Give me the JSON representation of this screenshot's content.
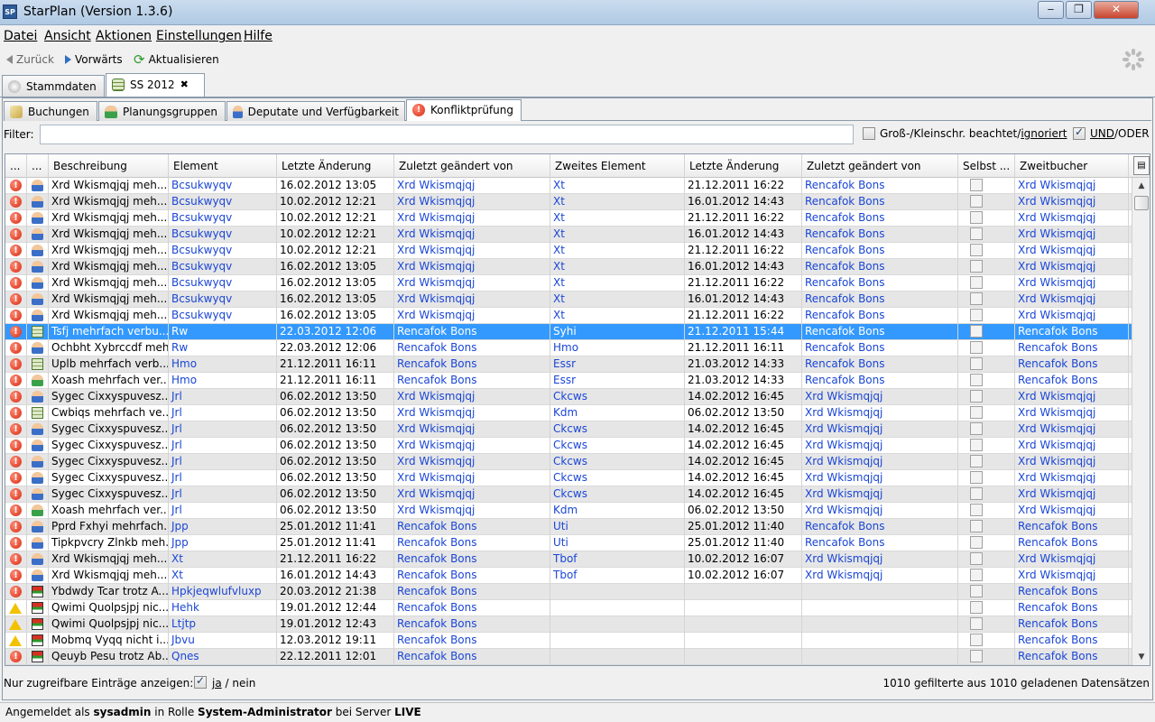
{
  "window": {
    "title": "StarPlan (Version 1.3.6)",
    "icon_text": "SP",
    "minimize": "‒",
    "maximize": "❐",
    "close": "✕"
  },
  "menu": [
    "Datei",
    "Ansicht",
    "Aktionen",
    "Einstellungen",
    "Hilfe"
  ],
  "nav": {
    "back": "Zurück",
    "forward": "Vorwärts",
    "refresh": "Aktualisieren"
  },
  "tabs_main": [
    {
      "label": "Stammdaten"
    },
    {
      "label": "SS 2012",
      "close": "✖"
    }
  ],
  "tabs_sub": [
    "Buchungen",
    "Planungsgruppen",
    "Deputate und Verfügbarkeit",
    "Konfliktprüfung"
  ],
  "filter": {
    "label": "Filter:",
    "value": "",
    "case_label_a": "Groß-/Kleinschr. beachtet/",
    "case_label_b": "ignoriert",
    "case_checked": false,
    "andor_a": "UND",
    "andor_b": "/ODER",
    "andor_checked": true
  },
  "columns": [
    "...",
    "...",
    "Beschreibung",
    "Element",
    "Letzte Änderung",
    "Zuletzt geändert von",
    "Zweites Element",
    "Letzte Änderung",
    "Zuletzt geändert von",
    "Selbst ...",
    "Zweitbucher"
  ],
  "rows": [
    {
      "s": "error",
      "t": "person",
      "desc": "Xrd Wkismqjqj meh...",
      "el": "Bcsukwyqv",
      "d1": "16.02.2012 13:05",
      "by1": "Xrd Wkismqjqj",
      "el2": "Xt",
      "d2": "21.12.2011 16:22",
      "by2": "Rencafok Bons",
      "zb": "Xrd Wkismqjqj"
    },
    {
      "s": "error",
      "t": "person",
      "desc": "Xrd Wkismqjqj meh...",
      "el": "Bcsukwyqv",
      "d1": "10.02.2012 12:21",
      "by1": "Xrd Wkismqjqj",
      "el2": "Xt",
      "d2": "16.01.2012 14:43",
      "by2": "Rencafok Bons",
      "zb": "Xrd Wkismqjqj"
    },
    {
      "s": "error",
      "t": "person",
      "desc": "Xrd Wkismqjqj meh...",
      "el": "Bcsukwyqv",
      "d1": "10.02.2012 12:21",
      "by1": "Xrd Wkismqjqj",
      "el2": "Xt",
      "d2": "21.12.2011 16:22",
      "by2": "Rencafok Bons",
      "zb": "Xrd Wkismqjqj"
    },
    {
      "s": "error",
      "t": "person",
      "desc": "Xrd Wkismqjqj meh...",
      "el": "Bcsukwyqv",
      "d1": "10.02.2012 12:21",
      "by1": "Xrd Wkismqjqj",
      "el2": "Xt",
      "d2": "16.01.2012 14:43",
      "by2": "Rencafok Bons",
      "zb": "Xrd Wkismqjqj"
    },
    {
      "s": "error",
      "t": "person",
      "desc": "Xrd Wkismqjqj meh...",
      "el": "Bcsukwyqv",
      "d1": "10.02.2012 12:21",
      "by1": "Xrd Wkismqjqj",
      "el2": "Xt",
      "d2": "21.12.2011 16:22",
      "by2": "Rencafok Bons",
      "zb": "Xrd Wkismqjqj"
    },
    {
      "s": "error",
      "t": "person",
      "desc": "Xrd Wkismqjqj meh...",
      "el": "Bcsukwyqv",
      "d1": "16.02.2012 13:05",
      "by1": "Xrd Wkismqjqj",
      "el2": "Xt",
      "d2": "16.01.2012 14:43",
      "by2": "Rencafok Bons",
      "zb": "Xrd Wkismqjqj"
    },
    {
      "s": "error",
      "t": "person",
      "desc": "Xrd Wkismqjqj meh...",
      "el": "Bcsukwyqv",
      "d1": "16.02.2012 13:05",
      "by1": "Xrd Wkismqjqj",
      "el2": "Xt",
      "d2": "21.12.2011 16:22",
      "by2": "Rencafok Bons",
      "zb": "Xrd Wkismqjqj"
    },
    {
      "s": "error",
      "t": "person",
      "desc": "Xrd Wkismqjqj meh...",
      "el": "Bcsukwyqv",
      "d1": "16.02.2012 13:05",
      "by1": "Xrd Wkismqjqj",
      "el2": "Xt",
      "d2": "16.01.2012 14:43",
      "by2": "Rencafok Bons",
      "zb": "Xrd Wkismqjqj"
    },
    {
      "s": "error",
      "t": "person",
      "desc": "Xrd Wkismqjqj meh...",
      "el": "Bcsukwyqv",
      "d1": "16.02.2012 13:05",
      "by1": "Xrd Wkismqjqj",
      "el2": "Xt",
      "d2": "21.12.2011 16:22",
      "by2": "Rencafok Bons",
      "zb": "Xrd Wkismqjqj"
    },
    {
      "s": "error",
      "t": "room",
      "desc": "Tsfj mehrfach verbu...",
      "el": "Rw",
      "d1": "22.03.2012 12:06",
      "by1": "Rencafok Bons",
      "el2": "Syhi",
      "d2": "21.12.2011 15:44",
      "by2": "Rencafok Bons",
      "zb": "Rencafok Bons",
      "selected": true
    },
    {
      "s": "error",
      "t": "person",
      "desc": "Ochbht Xybrccdf meh...",
      "el": "Rw",
      "d1": "22.03.2012 12:06",
      "by1": "Rencafok Bons",
      "el2": "Hmo",
      "d2": "21.12.2011 16:11",
      "by2": "Rencafok Bons",
      "zb": "Rencafok Bons"
    },
    {
      "s": "error",
      "t": "room",
      "desc": "Uplb mehrfach verb...",
      "el": "Hmo",
      "d1": "21.12.2011 16:11",
      "by1": "Rencafok Bons",
      "el2": "Essr",
      "d2": "21.03.2012 14:33",
      "by2": "Rencafok Bons",
      "zb": "Rencafok Bons"
    },
    {
      "s": "error",
      "t": "people",
      "desc": "Xoash mehrfach ver...",
      "el": "Hmo",
      "d1": "21.12.2011 16:11",
      "by1": "Rencafok Bons",
      "el2": "Essr",
      "d2": "21.03.2012 14:33",
      "by2": "Rencafok Bons",
      "zb": "Rencafok Bons"
    },
    {
      "s": "error",
      "t": "person",
      "desc": "Sygec Cixxyspuvesz...",
      "el": "Jrl",
      "d1": "06.02.2012 13:50",
      "by1": "Xrd Wkismqjqj",
      "el2": "Ckcws",
      "d2": "14.02.2012 16:45",
      "by2": "Xrd Wkismqjqj",
      "zb": "Xrd Wkismqjqj"
    },
    {
      "s": "error",
      "t": "room",
      "desc": "Cwbiqs mehrfach ve...",
      "el": "Jrl",
      "d1": "06.02.2012 13:50",
      "by1": "Xrd Wkismqjqj",
      "el2": "Kdm",
      "d2": "06.02.2012 13:50",
      "by2": "Xrd Wkismqjqj",
      "zb": "Xrd Wkismqjqj"
    },
    {
      "s": "error",
      "t": "person",
      "desc": "Sygec Cixxyspuvesz...",
      "el": "Jrl",
      "d1": "06.02.2012 13:50",
      "by1": "Xrd Wkismqjqj",
      "el2": "Ckcws",
      "d2": "14.02.2012 16:45",
      "by2": "Xrd Wkismqjqj",
      "zb": "Xrd Wkismqjqj"
    },
    {
      "s": "error",
      "t": "person",
      "desc": "Sygec Cixxyspuvesz...",
      "el": "Jrl",
      "d1": "06.02.2012 13:50",
      "by1": "Xrd Wkismqjqj",
      "el2": "Ckcws",
      "d2": "14.02.2012 16:45",
      "by2": "Xrd Wkismqjqj",
      "zb": "Xrd Wkismqjqj"
    },
    {
      "s": "error",
      "t": "person",
      "desc": "Sygec Cixxyspuvesz...",
      "el": "Jrl",
      "d1": "06.02.2012 13:50",
      "by1": "Xrd Wkismqjqj",
      "el2": "Ckcws",
      "d2": "14.02.2012 16:45",
      "by2": "Xrd Wkismqjqj",
      "zb": "Xrd Wkismqjqj"
    },
    {
      "s": "error",
      "t": "person",
      "desc": "Sygec Cixxyspuvesz...",
      "el": "Jrl",
      "d1": "06.02.2012 13:50",
      "by1": "Xrd Wkismqjqj",
      "el2": "Ckcws",
      "d2": "14.02.2012 16:45",
      "by2": "Xrd Wkismqjqj",
      "zb": "Xrd Wkismqjqj"
    },
    {
      "s": "error",
      "t": "person",
      "desc": "Sygec Cixxyspuvesz...",
      "el": "Jrl",
      "d1": "06.02.2012 13:50",
      "by1": "Xrd Wkismqjqj",
      "el2": "Ckcws",
      "d2": "14.02.2012 16:45",
      "by2": "Xrd Wkismqjqj",
      "zb": "Xrd Wkismqjqj"
    },
    {
      "s": "error",
      "t": "people",
      "desc": "Xoash mehrfach ver...",
      "el": "Jrl",
      "d1": "06.02.2012 13:50",
      "by1": "Xrd Wkismqjqj",
      "el2": "Kdm",
      "d2": "06.02.2012 13:50",
      "by2": "Xrd Wkismqjqj",
      "zb": "Xrd Wkismqjqj"
    },
    {
      "s": "error",
      "t": "person",
      "desc": "Pprd Fxhyi mehrfach...",
      "el": "Jpp",
      "d1": "25.01.2012 11:41",
      "by1": "Rencafok Bons",
      "el2": "Uti",
      "d2": "25.01.2012 11:40",
      "by2": "Rencafok Bons",
      "zb": "Rencafok Bons"
    },
    {
      "s": "error",
      "t": "person",
      "desc": "Tipkpvcry Zlnkb meh...",
      "el": "Jpp",
      "d1": "25.01.2012 11:41",
      "by1": "Rencafok Bons",
      "el2": "Uti",
      "d2": "25.01.2012 11:40",
      "by2": "Rencafok Bons",
      "zb": "Rencafok Bons"
    },
    {
      "s": "error",
      "t": "person",
      "desc": "Xrd Wkismqjqj meh...",
      "el": "Xt",
      "d1": "21.12.2011 16:22",
      "by1": "Rencafok Bons",
      "el2": "Tbof",
      "d2": "10.02.2012 16:07",
      "by2": "Xrd Wkismqjqj",
      "zb": "Xrd Wkismqjqj"
    },
    {
      "s": "error",
      "t": "person",
      "desc": "Xrd Wkismqjqj meh...",
      "el": "Xt",
      "d1": "16.01.2012 14:43",
      "by1": "Rencafok Bons",
      "el2": "Tbof",
      "d2": "10.02.2012 16:07",
      "by2": "Xrd Wkismqjqj",
      "zb": "Xrd Wkismqjqj"
    },
    {
      "s": "error",
      "t": "chart",
      "desc": "Ybdwdy Tcar trotz A...",
      "el": "Hpkjeqwlufvluxp",
      "d1": "20.03.2012 21:38",
      "by1": "Rencafok Bons",
      "el2": "",
      "d2": "",
      "by2": "",
      "zb": "Rencafok Bons"
    },
    {
      "s": "warn",
      "t": "chart",
      "desc": "Qwimi Quolpsjpj nic...",
      "el": "Hehk",
      "d1": "19.01.2012 12:44",
      "by1": "Rencafok Bons",
      "el2": "",
      "d2": "",
      "by2": "",
      "zb": "Rencafok Bons"
    },
    {
      "s": "warn",
      "t": "chart",
      "desc": "Qwimi Quolpsjpj nic...",
      "el": "Ltjtp",
      "d1": "19.01.2012 12:43",
      "by1": "Rencafok Bons",
      "el2": "",
      "d2": "",
      "by2": "",
      "zb": "Rencafok Bons"
    },
    {
      "s": "warn",
      "t": "chart",
      "desc": "Mobmq Vyqq nicht i...",
      "el": "Jbvu",
      "d1": "12.03.2012 19:11",
      "by1": "Rencafok Bons",
      "el2": "",
      "d2": "",
      "by2": "",
      "zb": "Rencafok Bons"
    },
    {
      "s": "error",
      "t": "chart",
      "desc": "Qeuyb Pesu trotz Ab...",
      "el": "Qnes",
      "d1": "22.12.2011 12:01",
      "by1": "Rencafok Bons",
      "el2": "",
      "d2": "",
      "by2": "",
      "zb": "Rencafok Bons"
    }
  ],
  "bottom": {
    "label": "Nur zugreifbare Einträge anzeigen:",
    "ja": "ja",
    "nein": "/ nein",
    "checked": true,
    "count": "1010 gefilterte aus 1010 geladenen Datensätzen"
  },
  "status": {
    "p1": "Angemeldet als ",
    "user": "sysadmin",
    "p2": " in Rolle ",
    "role": "System-Administrator",
    "p3": " bei Server ",
    "server": "LIVE"
  },
  "colors": {
    "link": "#1a46d6",
    "selection": "#3399ff",
    "error": "#d62b10",
    "warning": "#f2c200"
  }
}
